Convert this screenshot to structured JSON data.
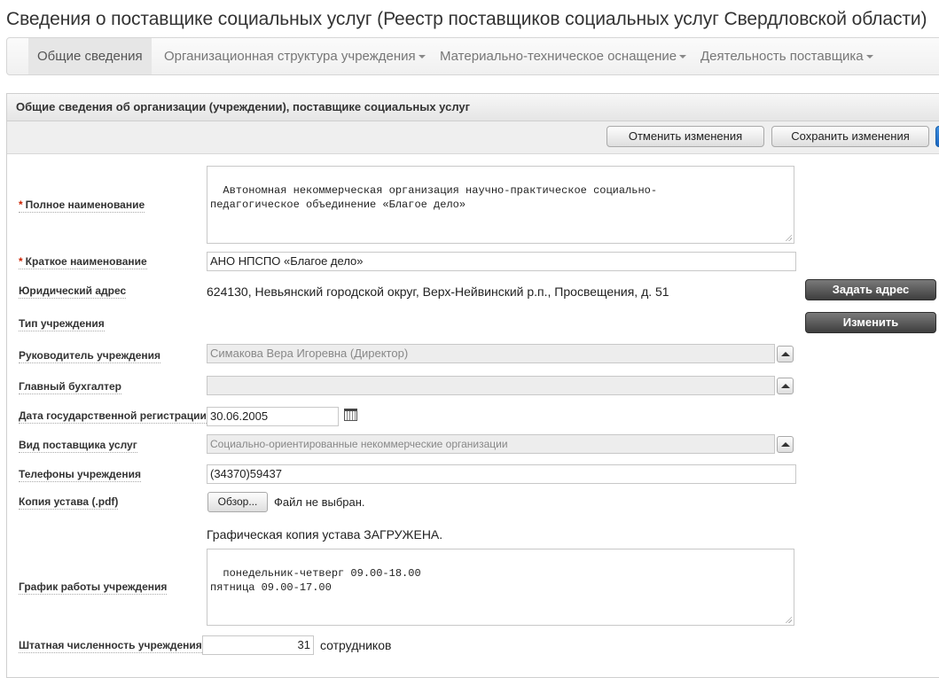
{
  "page": {
    "title": "Сведения о поставщике социальных услуг (Реестр поставщиков социальных услуг Свердловской области)"
  },
  "nav": {
    "tabs": [
      {
        "label": "Общие сведения",
        "active": true
      },
      {
        "label": "Организационная структура учреждения",
        "dropdown": true
      },
      {
        "label": "Материально-техническое оснащение",
        "dropdown": true
      },
      {
        "label": "Деятельность поставщика",
        "dropdown": true
      }
    ]
  },
  "panel": {
    "header": "Общие сведения об организации (учреждении), поставщике социальных услуг",
    "cancel_label": "Отменить изменения",
    "save_label": "Сохранить изменения"
  },
  "form": {
    "full_name": {
      "label": "Полное наименование",
      "value": "Автономная некоммерческая организация научно-практическое социально-\nпедагогическое объединение «Благое дело»"
    },
    "short_name": {
      "label": "Краткое наименование",
      "value": "АНО НПСПО «Благое дело»"
    },
    "legal_address": {
      "label": "Юридический адрес",
      "value": "624130, Невьянский городской округ, Верх-Нейвинский р.п., Просвещения, д. 51",
      "button": "Задать адрес"
    },
    "org_type": {
      "label": "Тип учреждения",
      "button": "Изменить"
    },
    "head": {
      "label": "Руководитель учреждения",
      "value": "Симакова Вера Игоревна (Директор)"
    },
    "chief_accountant": {
      "label": "Главный бухгалтер",
      "value": ""
    },
    "reg_date": {
      "label": "Дата государственной регистрации",
      "value": "30.06.2005"
    },
    "provider_kind": {
      "label": "Вид поставщика услуг",
      "value": "Социально-ориентированные некоммерческие организации"
    },
    "phones": {
      "label": "Телефоны учреждения",
      "value": "(34370)59437"
    },
    "charter_copy": {
      "label": "Копия устава (.pdf)",
      "browse": "Обзор...",
      "file_status": "Файл не выбран.",
      "uploaded_note": "Графическая копия устава ЗАГРУЖЕНА."
    },
    "schedule": {
      "label": "График работы учреждения",
      "value": "понедельник-четверг 09.00-18.00\nпятница 09.00-17.00"
    },
    "staff_count": {
      "label": "Штатная численность учреждения",
      "value": "31",
      "unit": "сотрудников"
    }
  }
}
